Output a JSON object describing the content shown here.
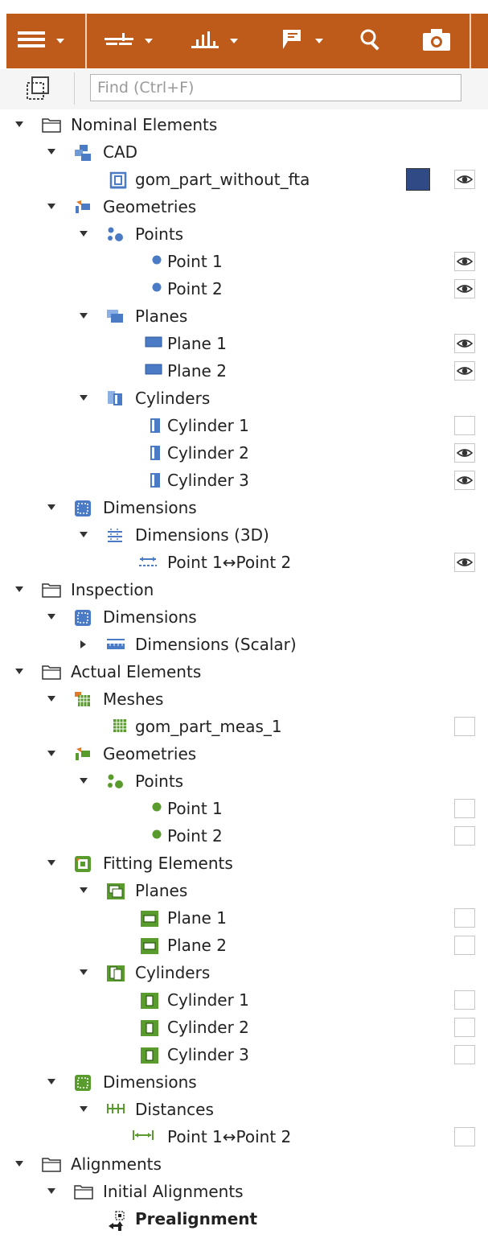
{
  "toolbar": {
    "menu_icon": "hamburger-icon",
    "groups": [
      "alignment-icon",
      "chart-icon",
      "report-icon"
    ],
    "search_icon": "search-icon",
    "snapshot_icon": "camera-icon"
  },
  "search": {
    "placeholder": "Find (Ctrl+F)"
  },
  "colors": {
    "toolbar": "#be5a1a",
    "nominal_blue": "#4a7bc4",
    "actual_green": "#5a9b2e",
    "cad_swatch": "#2f4a85"
  },
  "tree": [
    {
      "label": "Nominal Elements",
      "level": 0,
      "arrow": "down",
      "icon": "folder-icon",
      "vis": null
    },
    {
      "label": "CAD",
      "level": 1,
      "arrow": "down",
      "icon": "cad-icon",
      "vis": null
    },
    {
      "label": "gom_part_without_fta",
      "level": 2,
      "arrow": null,
      "icon": "part-icon",
      "vis": "eye",
      "swatch": "#2f4a85"
    },
    {
      "label": "Geometries",
      "level": 1,
      "arrow": "down",
      "icon": "geometries-blue-icon",
      "vis": null
    },
    {
      "label": "Points",
      "level": 2,
      "arrow": "down",
      "icon": "points-blue-icon",
      "vis": null
    },
    {
      "label": "Point 1",
      "level": 3,
      "arrow": null,
      "icon": "point-blue-icon",
      "vis": "eye"
    },
    {
      "label": "Point 2",
      "level": 3,
      "arrow": null,
      "icon": "point-blue-icon",
      "vis": "eye"
    },
    {
      "label": "Planes",
      "level": 2,
      "arrow": "down",
      "icon": "planes-blue-icon",
      "vis": null
    },
    {
      "label": "Plane 1",
      "level": 3,
      "arrow": null,
      "icon": "plane-blue-icon",
      "vis": "eye"
    },
    {
      "label": "Plane 2",
      "level": 3,
      "arrow": null,
      "icon": "plane-blue-icon",
      "vis": "eye"
    },
    {
      "label": "Cylinders",
      "level": 2,
      "arrow": "down",
      "icon": "cylinders-blue-icon",
      "vis": null
    },
    {
      "label": "Cylinder 1",
      "level": 3,
      "arrow": null,
      "icon": "cylinder-blue-icon",
      "vis": "empty"
    },
    {
      "label": "Cylinder 2",
      "level": 3,
      "arrow": null,
      "icon": "cylinder-blue-icon",
      "vis": "eye"
    },
    {
      "label": "Cylinder 3",
      "level": 3,
      "arrow": null,
      "icon": "cylinder-blue-icon",
      "vis": "eye"
    },
    {
      "label": "Dimensions",
      "level": 1,
      "arrow": "down",
      "icon": "dimensions-blue-icon",
      "vis": null
    },
    {
      "label": "Dimensions (3D)",
      "level": 2,
      "arrow": "down",
      "icon": "dimensions-3d-icon",
      "vis": null
    },
    {
      "label": "Point 1↔Point 2",
      "level": 3,
      "arrow": null,
      "icon": "distance-blue-icon",
      "vis": "eye"
    },
    {
      "label": "Inspection",
      "level": 0,
      "arrow": "down",
      "icon": "folder-icon",
      "vis": null
    },
    {
      "label": "Dimensions",
      "level": 1,
      "arrow": "down",
      "icon": "dimensions-blue-icon",
      "vis": null
    },
    {
      "label": "Dimensions (Scalar)",
      "level": 2,
      "arrow": "right",
      "icon": "ruler-icon",
      "vis": null
    },
    {
      "label": "Actual Elements",
      "level": 0,
      "arrow": "down",
      "icon": "folder-icon",
      "vis": null
    },
    {
      "label": "Meshes",
      "level": 1,
      "arrow": "down",
      "icon": "meshes-icon",
      "vis": null
    },
    {
      "label": "gom_part_meas_1",
      "level": 2,
      "arrow": null,
      "icon": "mesh-icon",
      "vis": "empty"
    },
    {
      "label": "Geometries",
      "level": 1,
      "arrow": "down",
      "icon": "geometries-green-icon",
      "vis": null
    },
    {
      "label": "Points",
      "level": 2,
      "arrow": "down",
      "icon": "points-green-icon",
      "vis": null
    },
    {
      "label": "Point 1",
      "level": 3,
      "arrow": null,
      "icon": "point-green-icon",
      "vis": "empty"
    },
    {
      "label": "Point 2",
      "level": 3,
      "arrow": null,
      "icon": "point-green-icon",
      "vis": "empty"
    },
    {
      "label": "Fitting Elements",
      "level": 1,
      "arrow": "down",
      "icon": "fitting-elements-icon",
      "vis": null
    },
    {
      "label": "Planes",
      "level": 2,
      "arrow": "down",
      "icon": "planes-green-icon",
      "vis": null
    },
    {
      "label": "Plane 1",
      "level": 3,
      "arrow": null,
      "icon": "plane-green-icon",
      "vis": "empty"
    },
    {
      "label": "Plane 2",
      "level": 3,
      "arrow": null,
      "icon": "plane-green-icon",
      "vis": "empty"
    },
    {
      "label": "Cylinders",
      "level": 2,
      "arrow": "down",
      "icon": "cylinders-green-icon",
      "vis": null
    },
    {
      "label": "Cylinder 1",
      "level": 3,
      "arrow": null,
      "icon": "cylinder-green-icon",
      "vis": "empty"
    },
    {
      "label": "Cylinder 2",
      "level": 3,
      "arrow": null,
      "icon": "cylinder-green-icon",
      "vis": "empty"
    },
    {
      "label": "Cylinder 3",
      "level": 3,
      "arrow": null,
      "icon": "cylinder-green-icon",
      "vis": "empty"
    },
    {
      "label": "Dimensions",
      "level": 1,
      "arrow": "down",
      "icon": "dimensions-green-icon",
      "vis": null
    },
    {
      "label": "Distances",
      "level": 2,
      "arrow": "down",
      "icon": "distances-icon",
      "vis": null
    },
    {
      "label": "Point 1↔Point 2",
      "level": 3,
      "arrow": null,
      "icon": "distance-green-icon",
      "vis": "empty"
    },
    {
      "label": "Alignments",
      "level": 0,
      "arrow": "down",
      "icon": "folder-icon",
      "vis": null
    },
    {
      "label": "Initial Alignments",
      "level": 1,
      "arrow": "down",
      "icon": "folder-icon",
      "vis": null
    },
    {
      "label": "Prealignment",
      "level": 2,
      "arrow": null,
      "icon": "prealignment-icon",
      "vis": null,
      "bold": true
    }
  ]
}
